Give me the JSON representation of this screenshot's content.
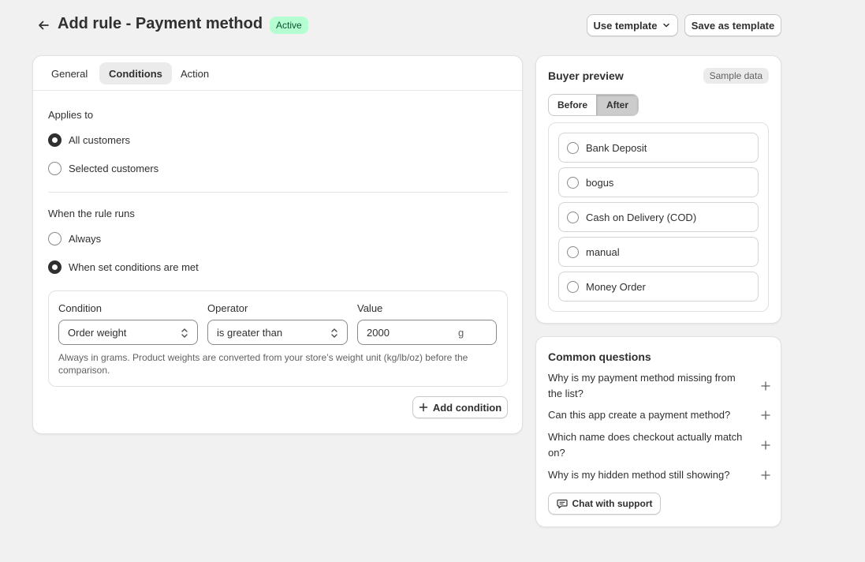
{
  "header": {
    "title": "Add rule - Payment method",
    "status": "Active",
    "use_template": "Use template",
    "save_template": "Save as template"
  },
  "tabs": [
    {
      "label": "General",
      "active": false
    },
    {
      "label": "Conditions",
      "active": true
    },
    {
      "label": "Action",
      "active": false
    }
  ],
  "applies_to": {
    "label": "Applies to",
    "options": [
      {
        "label": "All customers",
        "checked": true
      },
      {
        "label": "Selected customers",
        "checked": false
      }
    ]
  },
  "rule_runs": {
    "label": "When the rule runs",
    "options": [
      {
        "label": "Always",
        "checked": false
      },
      {
        "label": "When set conditions are met",
        "checked": true
      }
    ]
  },
  "condition": {
    "condition_label": "Condition",
    "condition_value": "Order weight",
    "operator_label": "Operator",
    "operator_value": "is greater than",
    "value_label": "Value",
    "value": "2000",
    "unit": "g",
    "help": "Always in grams. Product weights are converted from your store’s weight unit (kg/lb/oz) before the comparison.",
    "add_button": "Add condition"
  },
  "preview": {
    "title": "Buyer preview",
    "badge": "Sample data",
    "before": "Before",
    "after": "After",
    "methods": [
      "Bank Deposit",
      "bogus",
      "Cash on Delivery (COD)",
      "manual",
      "Money Order"
    ]
  },
  "faq": {
    "title": "Common questions",
    "questions": [
      "Why is my payment method missing from the list?",
      "Can this app create a payment method?",
      "Which name does checkout actually match on?",
      "Why is my hidden method still showing?"
    ],
    "chat_button": "Chat with support"
  }
}
